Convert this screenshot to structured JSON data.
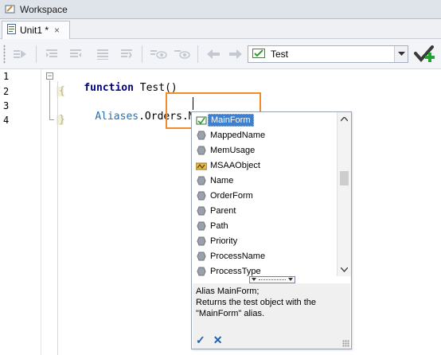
{
  "window": {
    "title": "Workspace",
    "icon": "workspace-icon"
  },
  "tabs": [
    {
      "label": "Unit1 *",
      "icon": "script-unit-icon",
      "close": "×"
    }
  ],
  "toolbar": {
    "buttons": [
      "run-script-icon",
      "indent-left-icon",
      "indent-right-icon",
      "align-icon",
      "wrap-icon",
      "hide-icon",
      "watch-icon",
      "navigate-back-icon",
      "navigate-forward-icon"
    ],
    "test_combo": {
      "value": "Test",
      "icon": "test-routine-icon"
    },
    "run_button_icon": "run-checkmark-icon"
  },
  "editor": {
    "line_numbers": [
      "1",
      "2",
      "3",
      "4"
    ],
    "lines": {
      "l1_kw": "function",
      "l1_rest": " Test()",
      "l2": "{",
      "l3_obj": "Aliases",
      "l3_rest": ".Orders.Main",
      "l4": "}"
    },
    "fold_glyph": "−"
  },
  "autocomplete": {
    "items": [
      {
        "label": "MainForm",
        "icon": "alias-object-icon",
        "selected": true
      },
      {
        "label": "MappedName",
        "icon": "property-icon"
      },
      {
        "label": "MemUsage",
        "icon": "property-icon"
      },
      {
        "label": "MSAAObject",
        "icon": "msaa-object-icon"
      },
      {
        "label": "Name",
        "icon": "property-icon"
      },
      {
        "label": "OrderForm",
        "icon": "property-icon"
      },
      {
        "label": "Parent",
        "icon": "property-icon"
      },
      {
        "label": "Path",
        "icon": "property-icon"
      },
      {
        "label": "Priority",
        "icon": "property-icon"
      },
      {
        "label": "ProcessName",
        "icon": "property-icon"
      },
      {
        "label": "ProcessType",
        "icon": "property-icon"
      }
    ],
    "description": {
      "line1": "Alias MainForm;",
      "line2": "Returns the test object with the",
      "line3": "\"MainForm\" alias."
    },
    "ok_glyph": "✓",
    "cancel_glyph": "✕"
  },
  "colors": {
    "accent_highlight": "#f28c28",
    "selection": "#3d7fd0",
    "keyword": "#000080",
    "alias_text": "#2b6ea8"
  }
}
